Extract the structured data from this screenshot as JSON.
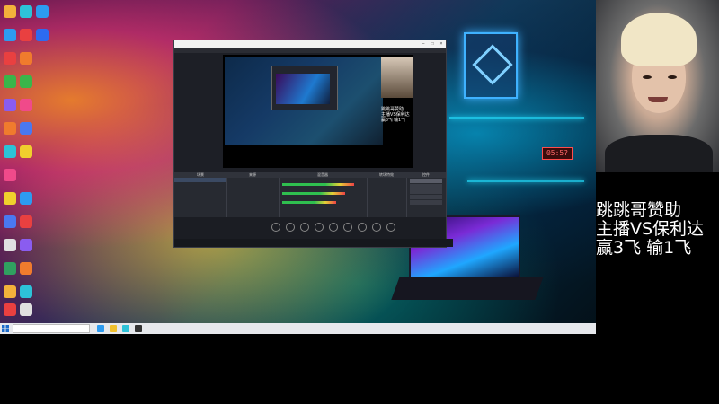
{
  "stream_overlay": {
    "lines": [
      "跳跳哥赞助",
      "主播VS保利达",
      "赢3飞  输1飞"
    ]
  },
  "desktop": {
    "wall_clock": "05:5?",
    "icons": [
      {
        "name": "icon-1",
        "color": "#f3b13b"
      },
      {
        "name": "icon-2",
        "color": "#2d9bf0"
      },
      {
        "name": "icon-3",
        "color": "#e94040"
      },
      {
        "name": "icon-4",
        "color": "#3ab54a"
      },
      {
        "name": "icon-5",
        "color": "#8a5cf0"
      },
      {
        "name": "icon-6",
        "color": "#f07b2d"
      },
      {
        "name": "icon-7",
        "color": "#2dc2d8"
      },
      {
        "name": "icon-8",
        "color": "#f04a8a"
      },
      {
        "name": "icon-9",
        "color": "#f0d02d"
      },
      {
        "name": "icon-10",
        "color": "#4a78f0"
      },
      {
        "name": "icon-11",
        "color": "#e0e0e0"
      },
      {
        "name": "icon-12",
        "color": "#30a060"
      }
    ]
  },
  "obs": {
    "preview_caption": [
      "跳跳哥赞助",
      "主播VS保利达",
      "赢3飞 输1飞"
    ],
    "docks": {
      "scenes": "场景",
      "sources": "来源",
      "mixer": "混音器",
      "transitions": "转场特效",
      "controls": "控件"
    }
  },
  "taskbar": {
    "accent": "#e6e8ec"
  },
  "colors": {
    "neon_cyan": "#25e0ff",
    "overlay_text": "#ffffff"
  }
}
